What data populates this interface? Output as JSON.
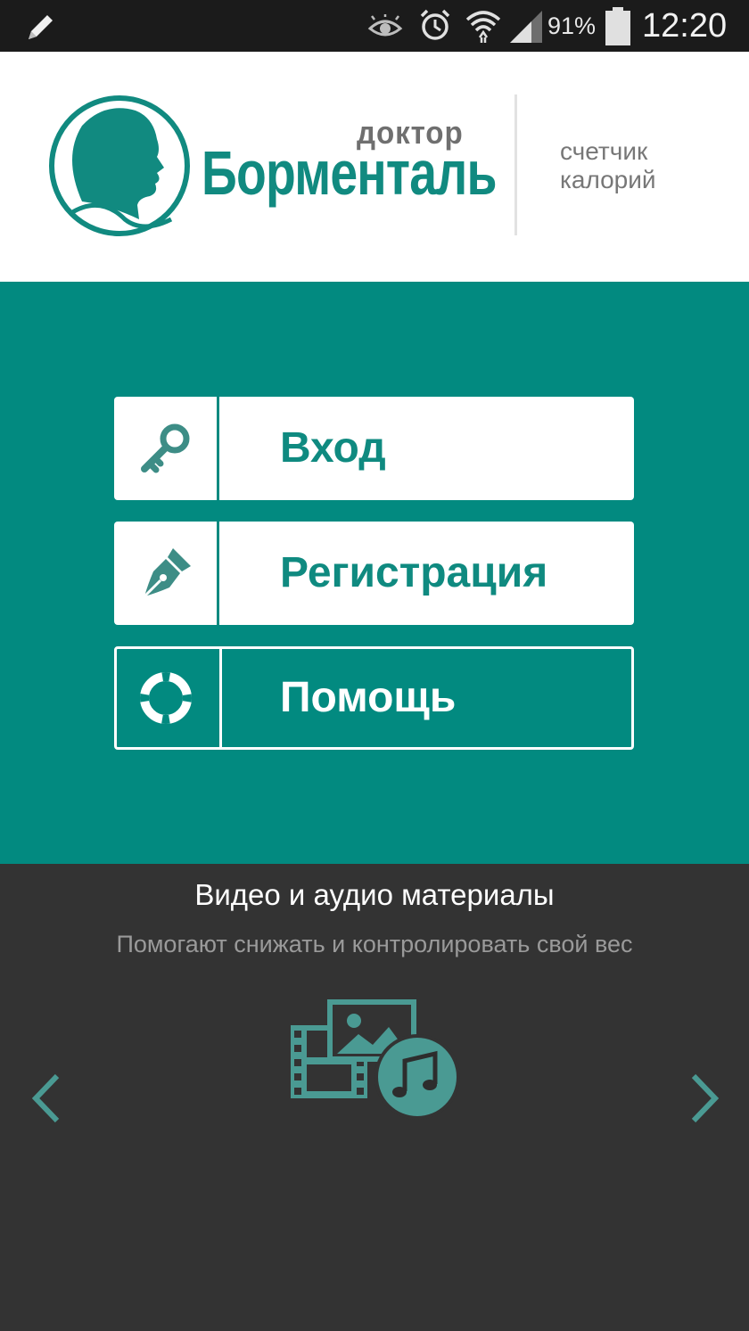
{
  "status_bar": {
    "battery": "91%",
    "time": "12:20"
  },
  "header": {
    "logo_small": "доктор",
    "logo_name": "Борменталь",
    "tagline_line1": "счетчик",
    "tagline_line2": "калорий"
  },
  "menu": {
    "login_label": "Вход",
    "register_label": "Регистрация",
    "help_label": "Помощь"
  },
  "media": {
    "title": "Видео и аудио материалы",
    "subtitle": "Помогают снижать и контролировать свой вес"
  },
  "colors": {
    "teal": "#028a80",
    "dark": "#333333",
    "icon_teal": "#4a9a93"
  }
}
